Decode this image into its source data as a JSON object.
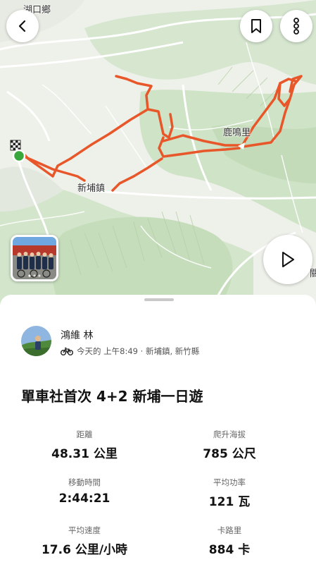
{
  "map": {
    "place_labels": [
      "湖口鄉",
      "鹿鳴里",
      "新埔鎮",
      "關"
    ],
    "route_color": "#e8572a"
  },
  "buttons": {
    "back_icon": "chevron-left-icon",
    "bookmark_icon": "bookmark-icon",
    "more_icon": "more-vertical-icon",
    "play_icon": "play-icon"
  },
  "activity": {
    "athlete_name": "鴻維 林",
    "sport_icon": "bicycle-icon",
    "meta": "今天的 上午8:49 · 新埔鎮, 新竹縣",
    "title": "單車社首次 4+2 新埔一日遊",
    "stats": [
      {
        "label": "距離",
        "value": "48.31 公里"
      },
      {
        "label": "爬升海拔",
        "value": "785 公尺"
      },
      {
        "label": "移動時間",
        "value": "2:44:21"
      },
      {
        "label": "平均功率",
        "value": "121 瓦"
      },
      {
        "label": "平均速度",
        "value": "17.6 公里/小時"
      },
      {
        "label": "卡路里",
        "value": "884 卡"
      }
    ]
  }
}
